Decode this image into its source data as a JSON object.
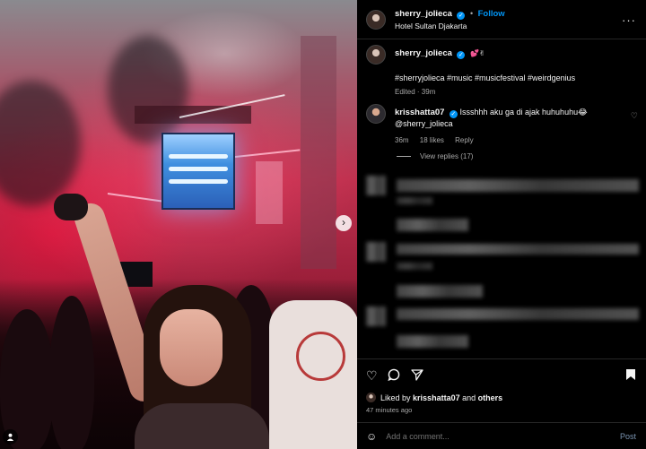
{
  "post": {
    "username": "sherry_jolieca",
    "follow_label": "Follow",
    "separator": "•",
    "location": "Hotel Sultan Djakarta",
    "more_label": "···"
  },
  "caption": {
    "username": "sherry_jolieca",
    "emoji": "💕✌",
    "hashtags": "#sherryjolieca #music #musicfestival #weirdgenius",
    "meta": "Edited · 39m"
  },
  "comment": {
    "username": "krisshatta07",
    "text": "Issshhh aku ga di ajak huhuhuhu😂",
    "mention": "@sherry_jolieca",
    "time": "36m",
    "likes": "18 likes",
    "reply_label": "Reply"
  },
  "replies": {
    "label": "View replies (17)"
  },
  "likes": {
    "prefix": "Liked by",
    "user": "krisshatta07",
    "conj": "and",
    "others": "others",
    "ago": "47 minutes ago"
  },
  "add_comment": {
    "placeholder": "Add a comment...",
    "post_label": "Post"
  },
  "icons": [
    "heart-icon",
    "comment-icon",
    "share-icon",
    "bookmark-icon",
    "smile-icon",
    "chevron-right-icon",
    "verified-icon",
    "more-icon"
  ],
  "colors": {
    "accent": "#0095f6",
    "background": "#000000",
    "muted": "#a8a8a8"
  }
}
